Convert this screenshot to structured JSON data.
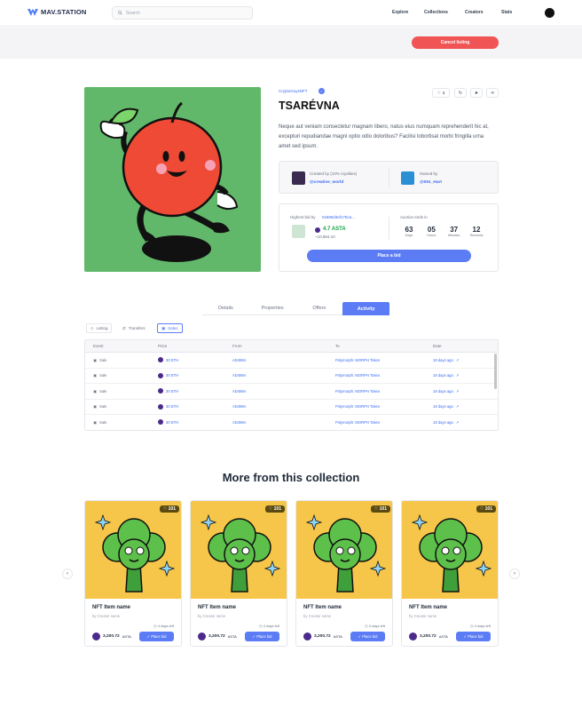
{
  "header": {
    "logo_text": "MAV.STATION",
    "search_placeholder": "Search",
    "nav": [
      "Explore",
      "Collections",
      "Creators",
      "Stats"
    ]
  },
  "banner": {
    "cancel_label": "Cancel listing"
  },
  "item": {
    "collection": "CryptoGuysNFT",
    "title": "TSARÉVNA",
    "description": "Neque aut veniam consectetur magnam libero, natus eius numquam reprehenderit hic at, excepturi repudiandae magni optio odio doloribus? Facilisi lobortisal morbi fringilla urna amet sed ipsum.",
    "likes": "3",
    "created_by_label": "Created by (10% royalties)",
    "creator": "@creative_world",
    "owned_by_label": "Owned by",
    "owner": "@051_Hart",
    "highest_bid_label": "Highest bid by",
    "highest_bidder": "0x695d3ef176ca…",
    "bid_amount": "4.7 ASTA",
    "bid_usd": "~10,864.10",
    "auction_label": "Auction ends in",
    "countdown": [
      {
        "value": "63",
        "unit": "Days"
      },
      {
        "value": "05",
        "unit": "Hours"
      },
      {
        "value": "37",
        "unit": "Minutes"
      },
      {
        "value": "12",
        "unit": "Seconds"
      }
    ],
    "place_bid_label": "Place a bid"
  },
  "tabs": [
    "Details",
    "Properties",
    "Offers",
    "Activity"
  ],
  "filters": [
    "Listing",
    "Transfers",
    "Sales"
  ],
  "activity": {
    "columns": [
      "Event",
      "Price",
      "From",
      "To",
      "Date"
    ],
    "rows": [
      {
        "event": "Sale",
        "price": "30 ETH",
        "from": "AD496A",
        "to": "Polymorph: MORPH Token",
        "date": "19 days ago"
      },
      {
        "event": "Sale",
        "price": "30 ETH",
        "from": "AD496A",
        "to": "Polymorph: MORPH Token",
        "date": "19 days ago"
      },
      {
        "event": "Sale",
        "price": "30 ETH",
        "from": "AD496A",
        "to": "Polymorph: MORPH Token",
        "date": "19 days ago"
      },
      {
        "event": "Sale",
        "price": "30 ETH",
        "from": "AD496A",
        "to": "Polymorph: MORPH Token",
        "date": "19 days ago"
      },
      {
        "event": "Sale",
        "price": "30 ETH",
        "from": "AD496A",
        "to": "Polymorph: MORPH Token",
        "date": "19 days ago"
      }
    ]
  },
  "more": {
    "title": "More from this collection",
    "cards": [
      {
        "likes": "101",
        "name": "NFT Item name",
        "creator": "by Creator name",
        "days": "4 days left",
        "price": "3,200.72",
        "currency": "ASTA",
        "bid": "Place bid"
      },
      {
        "likes": "101",
        "name": "NFT Item name",
        "creator": "by Creator name",
        "days": "4 days left",
        "price": "3,200.72",
        "currency": "ASTA",
        "bid": "Place bid"
      },
      {
        "likes": "101",
        "name": "NFT Item name",
        "creator": "by Creator name",
        "days": "4 days left",
        "price": "3,200.72",
        "currency": "ASTA",
        "bid": "Place bid"
      },
      {
        "likes": "101",
        "name": "NFT Item name",
        "creator": "by Creator name",
        "days": "4 days left",
        "price": "3,200.72",
        "currency": "ASTA",
        "bid": "Place bid"
      }
    ]
  },
  "colors": {
    "accent": "#5b7cf5",
    "danger": "#f05454",
    "art_bg": "#62b86a",
    "card_bg": "#f5c64a"
  }
}
